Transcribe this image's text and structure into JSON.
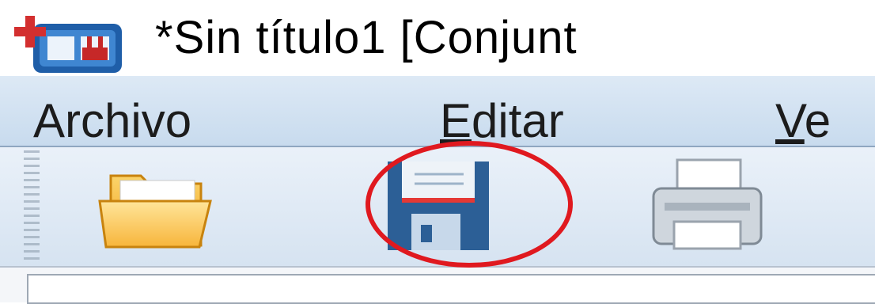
{
  "window": {
    "title": "*Sin título1 [Conjunt",
    "app_icon": "spss-statistics-icon"
  },
  "menubar": {
    "items": [
      {
        "label": "Archivo",
        "mnemonic": ""
      },
      {
        "label": "Editar",
        "mnemonic": "E"
      },
      {
        "label": "Ve",
        "mnemonic": "V"
      }
    ]
  },
  "toolbar": {
    "buttons": [
      {
        "name": "open-folder",
        "icon": "folder-open-icon"
      },
      {
        "name": "save",
        "icon": "floppy-disk-icon",
        "highlighted": true
      },
      {
        "name": "print",
        "icon": "printer-icon"
      }
    ]
  },
  "colors": {
    "highlight": "#e0191f",
    "menubar": "#d3e2f2",
    "toolbar": "#e2ebf5"
  }
}
